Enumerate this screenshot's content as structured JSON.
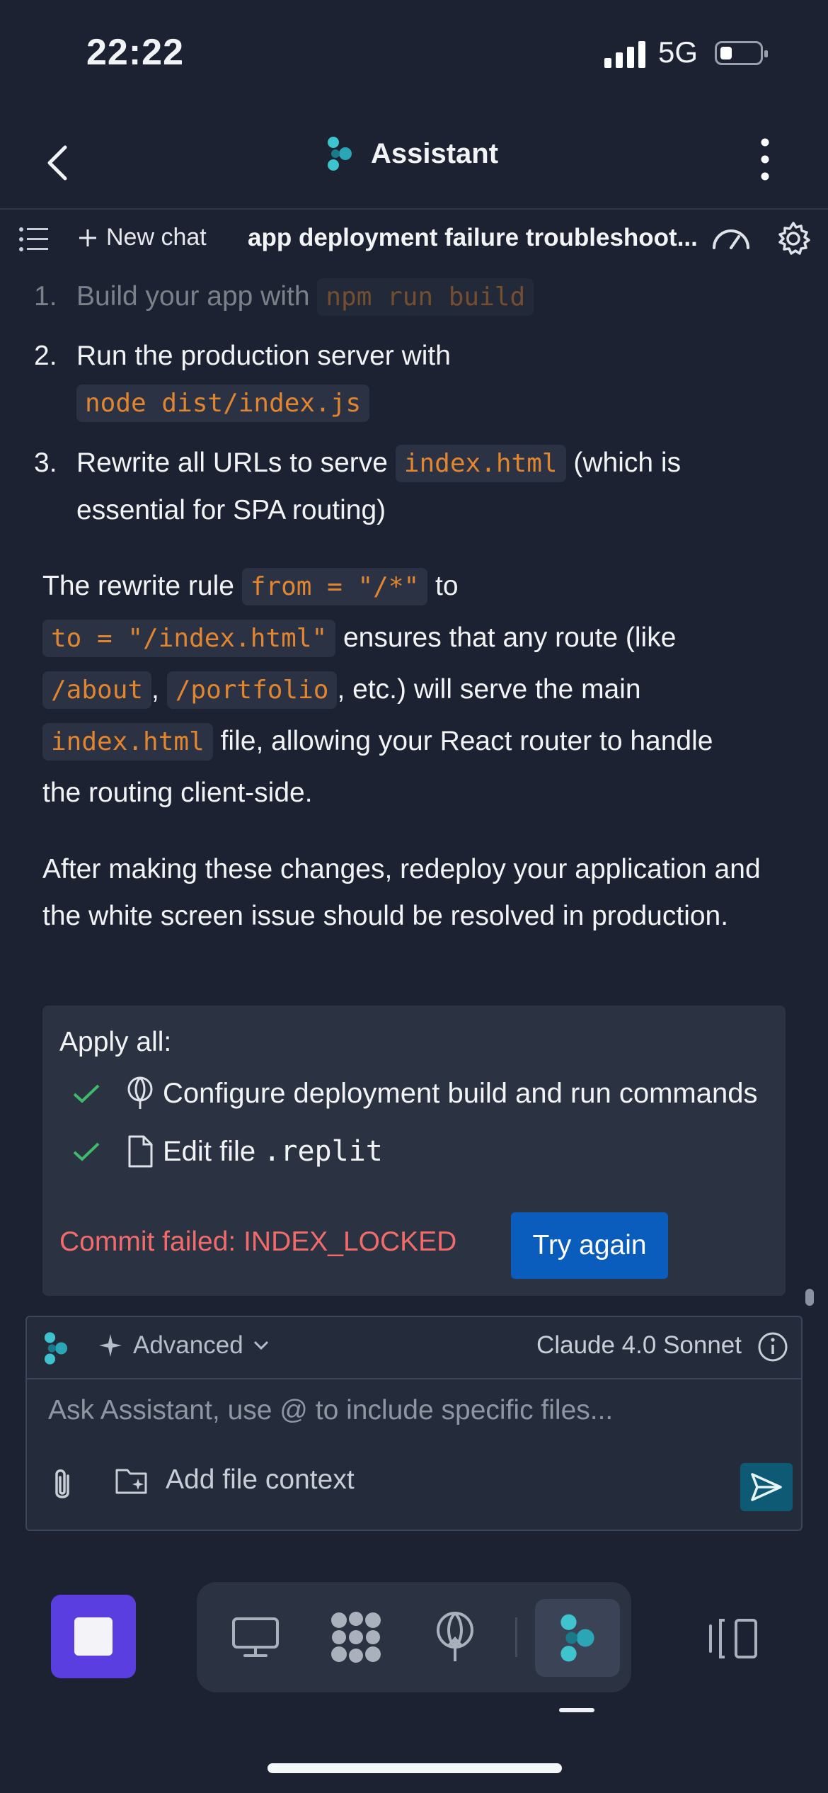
{
  "status_bar": {
    "time": "22:22",
    "network": "5G"
  },
  "header": {
    "title": "Assistant"
  },
  "toolbar": {
    "new_chat": "New chat",
    "chat_title": "app deployment failure troubleshoot..."
  },
  "message": {
    "steps": [
      {
        "num": "1.",
        "pre": "Build your app with ",
        "code": "npm run build"
      },
      {
        "num": "2.",
        "pre": "Run the production server with",
        "code": "node dist/index.js"
      },
      {
        "num": "3.",
        "pre": "Rewrite all URLs to serve ",
        "code": "index.html",
        "post": " (which is",
        "post2": "essential for SPA routing)"
      }
    ],
    "rewrite": {
      "t1": "The rewrite rule ",
      "c1": "from = \"/*\"",
      "t2": " to",
      "c2": "to = \"/index.html\"",
      "t3": " ensures that any route (like",
      "c3": "/about",
      "t4": ", ",
      "c4": "/portfolio",
      "t5": ", etc.) will serve the main",
      "c5": "index.html",
      "t6": " file, allowing your React router to handle",
      "t7": "the routing client-side."
    },
    "after": "After making these changes, redeploy your application and the white screen issue should be resolved in production."
  },
  "apply_card": {
    "title": "Apply all:",
    "items": [
      {
        "label": "Configure deployment build and run commands",
        "icon": "deploy-icon"
      },
      {
        "label_pre": "Edit file ",
        "label_code": ".replit",
        "icon": "file-icon"
      }
    ],
    "error": "Commit failed: INDEX_LOCKED",
    "retry": "Try again"
  },
  "composer": {
    "mode": "Advanced",
    "model": "Claude 4.0 Sonnet",
    "placeholder": "Ask Assistant, use @ to include specific files...",
    "add_context": "Add file context"
  },
  "colors": {
    "background": "#1c2231",
    "code_text": "#e2852f",
    "error": "#f26b6b",
    "primary_button": "#0a5cbd",
    "stop_button": "#5b3ee0",
    "send_button": "#0e5a74",
    "check": "#3fb96a"
  }
}
